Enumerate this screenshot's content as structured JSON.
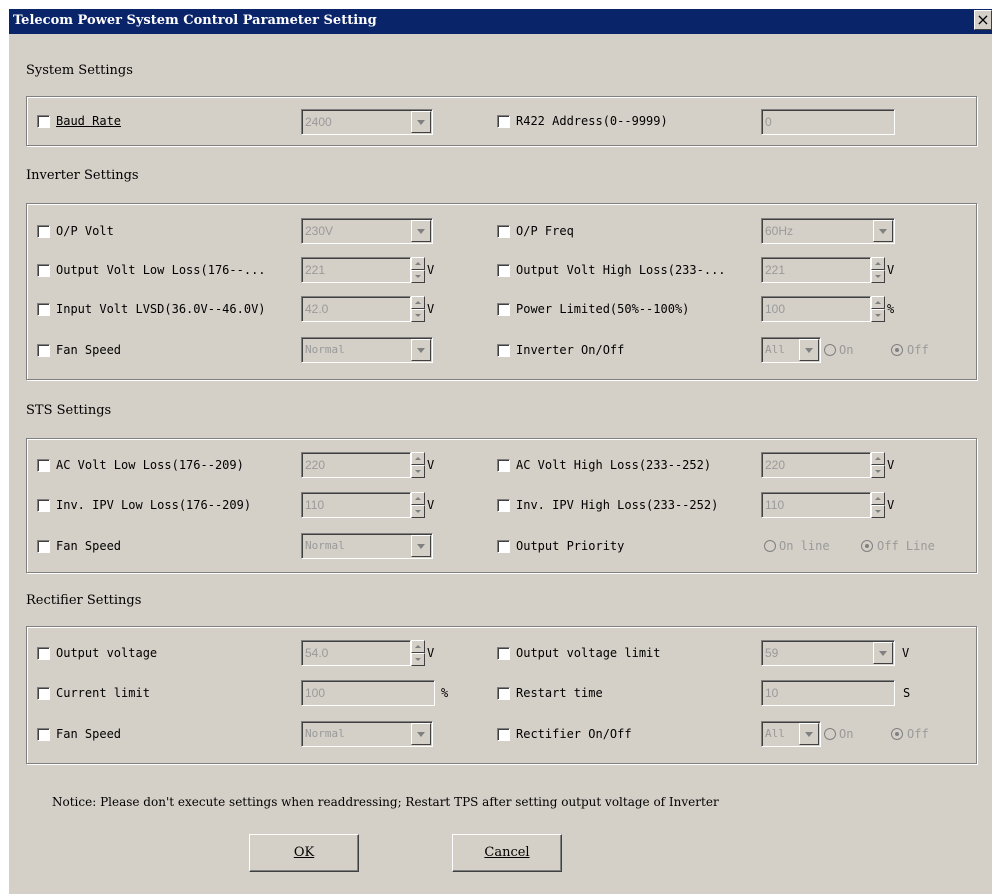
{
  "window": {
    "title": "Telecom Power System Control Parameter Setting",
    "close": "×"
  },
  "system": {
    "title": "System Settings",
    "baud_rate": {
      "label": "Baud Rate",
      "value": "2400"
    },
    "r422": {
      "label": "R422 Address(0--9999)",
      "value": "0"
    }
  },
  "inverter": {
    "title": "Inverter Settings",
    "op_volt": {
      "label": "O/P Volt",
      "value": "230V"
    },
    "op_freq": {
      "label": "O/P Freq",
      "value": "60Hz"
    },
    "low_loss": {
      "label": "Output Volt Low Loss(176--...",
      "value": "221",
      "unit": "V"
    },
    "high_loss": {
      "label": "Output Volt High Loss(233-...",
      "value": "221",
      "unit": "V"
    },
    "lvsd": {
      "label": "Input Volt LVSD(36.0V--46.0V)",
      "value": "42.0",
      "unit": "V"
    },
    "power_limited": {
      "label": "Power Limited(50%--100%)",
      "value": "100",
      "unit": "%"
    },
    "fan_speed": {
      "label": "Fan Speed",
      "value": "Normal"
    },
    "onoff": {
      "label": "Inverter On/Off",
      "value": "All",
      "on": "On",
      "off": "Off"
    }
  },
  "sts": {
    "title": "STS Settings",
    "ac_low": {
      "label": "AC Volt Low Loss(176--209)",
      "value": "220",
      "unit": "V"
    },
    "ac_high": {
      "label": "AC Volt High Loss(233--252)",
      "value": "220",
      "unit": "V"
    },
    "ipv_low": {
      "label": "Inv. IPV Low Loss(176--209)",
      "value": "110",
      "unit": "V"
    },
    "ipv_high": {
      "label": "Inv. IPV High Loss(233--252)",
      "value": "110",
      "unit": "V"
    },
    "fan_speed": {
      "label": "Fan Speed",
      "value": "Normal"
    },
    "priority": {
      "label": "Output Priority",
      "online": "On line",
      "offline": "Off Line"
    }
  },
  "rectifier": {
    "title": "Rectifier Settings",
    "out_volt": {
      "label": "Output voltage",
      "value": "54.0",
      "unit": "V"
    },
    "volt_limit": {
      "label": "Output voltage limit",
      "value": "59",
      "unit": "V"
    },
    "current_limit": {
      "label": "Current limit",
      "value": "100",
      "unit": "%"
    },
    "restart": {
      "label": "Restart time",
      "value": "10",
      "unit": "S"
    },
    "fan_speed": {
      "label": "Fan Speed",
      "value": "Normal"
    },
    "onoff": {
      "label": "Rectifier On/Off",
      "value": "All",
      "on": "On",
      "off": "Off"
    }
  },
  "notice": "Notice: Please don't execute settings when readdressing; Restart TPS after setting output voltage of Inverter",
  "buttons": {
    "ok": "OK",
    "cancel": "Cancel"
  }
}
